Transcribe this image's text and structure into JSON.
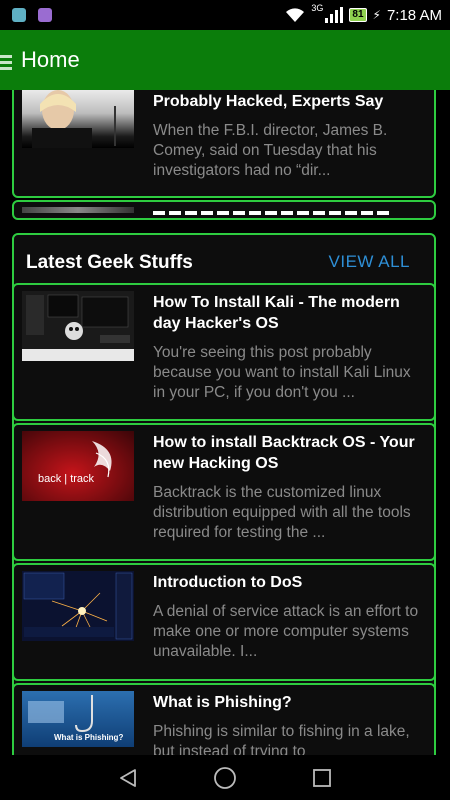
{
  "status_bar": {
    "network": "3G",
    "battery": "81",
    "time": "7:18 AM"
  },
  "app_bar": {
    "title": "Home"
  },
  "top_partial_card": {
    "title": "Probably Hacked, Experts Say",
    "excerpt": "When the F.B.I. director, James B. Comey, said on Tuesday that his investigators had no “dir..."
  },
  "section": {
    "title": "Latest Geek Stuffs",
    "view_all_label": "VIEW ALL",
    "posts": [
      {
        "title": "How To Install Kali - The modern day Hacker's OS",
        "excerpt": "You're seeing this post probably because you want to install Kali Linux in your PC, if you don't you ...",
        "thumb": "kali-terminal"
      },
      {
        "title": "How to install Backtrack OS - Your new Hacking OS",
        "excerpt": "Backtrack is the customized linux distribution equipped with all the tools required for testing the ...",
        "thumb": "backtrack-logo",
        "thumb_text": "back | track"
      },
      {
        "title": "Introduction to DoS",
        "excerpt": "A denial of service attack is an effort to make one or more computer systems unavailable. I...",
        "thumb": "dos-sparks"
      },
      {
        "title": "What is Phishing?",
        "excerpt": "Phishing is similar to fishing in a lake, but instead of trying to",
        "thumb": "phishing",
        "thumb_text": "What is Phishing?"
      }
    ]
  },
  "colors": {
    "accent_green": "#0b7d0b",
    "card_border": "#2ecc40",
    "link_blue": "#2e8fd6"
  }
}
